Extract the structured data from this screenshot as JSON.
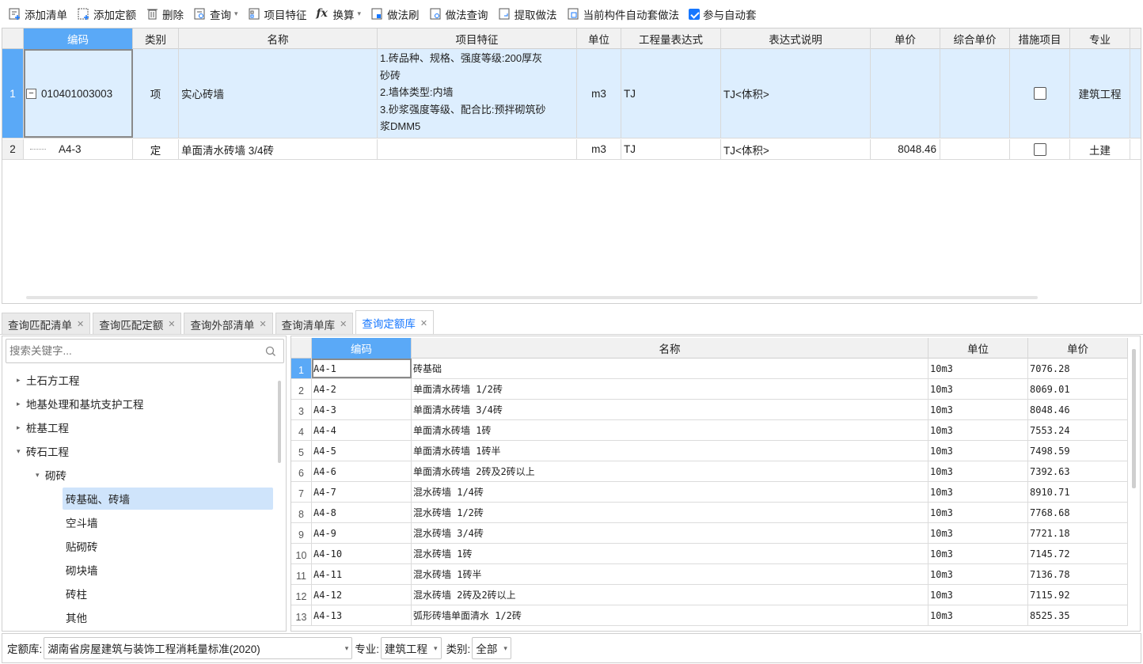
{
  "toolbar": {
    "items": [
      {
        "label": "添加清单",
        "icon": "add-list-icon"
      },
      {
        "label": "添加定额",
        "icon": "add-quota-icon"
      },
      {
        "label": "删除",
        "icon": "trash-icon"
      },
      {
        "label": "查询",
        "icon": "query-icon",
        "dropdown": true
      },
      {
        "label": "项目特征",
        "icon": "feature-icon"
      },
      {
        "label": "换算",
        "icon": "fx-icon",
        "dropdown": true
      },
      {
        "label": "做法刷",
        "icon": "brush-icon"
      },
      {
        "label": "做法查询",
        "icon": "method-query-icon"
      },
      {
        "label": "提取做法",
        "icon": "extract-icon"
      },
      {
        "label": "当前构件自动套做法",
        "icon": "auto-apply-icon"
      }
    ],
    "auto_checkbox_label": "参与自动套",
    "auto_checked": true
  },
  "top_grid": {
    "headers": [
      "编码",
      "类别",
      "名称",
      "项目特征",
      "单位",
      "工程量表达式",
      "表达式说明",
      "单价",
      "综合单价",
      "措施项目",
      "专业"
    ],
    "rows": [
      {
        "num": "1",
        "code": "010401003003",
        "type": "项",
        "name": "实心砖墙",
        "feature": "1.砖品种、规格、强度等级:200厚灰\n砂砖\n2.墙体类型:内墙\n3.砂浆强度等级、配合比:预拌砌筑砂\n浆DMM5",
        "unit": "m3",
        "expr": "TJ",
        "expr_desc": "TJ<体积>",
        "price": "",
        "total_price": "",
        "measure": false,
        "major": "建筑工程"
      },
      {
        "num": "2",
        "code": "A4-3",
        "type": "定",
        "name": "单面清水砖墙 3/4砖",
        "feature": "",
        "unit": "m3",
        "expr": "TJ",
        "expr_desc": "TJ<体积>",
        "price": "8048.46",
        "total_price": "",
        "measure": false,
        "major": "土建"
      }
    ]
  },
  "tabs": [
    {
      "label": "查询匹配清单",
      "active": false
    },
    {
      "label": "查询匹配定额",
      "active": false
    },
    {
      "label": "查询外部清单",
      "active": false
    },
    {
      "label": "查询清单库",
      "active": false
    },
    {
      "label": "查询定额库",
      "active": true
    }
  ],
  "search": {
    "placeholder": "搜索关键字..."
  },
  "tree": [
    {
      "label": "土石方工程",
      "level": 0,
      "arrow": "right"
    },
    {
      "label": "地基处理和基坑支护工程",
      "level": 0,
      "arrow": "right"
    },
    {
      "label": "桩基工程",
      "level": 0,
      "arrow": "right"
    },
    {
      "label": "砖石工程",
      "level": 0,
      "arrow": "down"
    },
    {
      "label": "砌砖",
      "level": 1,
      "arrow": "down"
    },
    {
      "label": "砖基础、砖墙",
      "level": 2,
      "arrow": "",
      "selected": true
    },
    {
      "label": "空斗墙",
      "level": 2,
      "arrow": ""
    },
    {
      "label": "贴砌砖",
      "level": 2,
      "arrow": ""
    },
    {
      "label": "砌块墙",
      "level": 2,
      "arrow": ""
    },
    {
      "label": "砖柱",
      "level": 2,
      "arrow": ""
    },
    {
      "label": "其他",
      "level": 2,
      "arrow": ""
    }
  ],
  "quota_grid": {
    "headers": [
      "编码",
      "名称",
      "单位",
      "单价"
    ],
    "rows": [
      {
        "num": "1",
        "code": "A4-1",
        "name": "砖基础",
        "unit": "10m3",
        "price": "7076.28"
      },
      {
        "num": "2",
        "code": "A4-2",
        "name": "单面清水砖墙 1/2砖",
        "unit": "10m3",
        "price": "8069.01"
      },
      {
        "num": "3",
        "code": "A4-3",
        "name": "单面清水砖墙 3/4砖",
        "unit": "10m3",
        "price": "8048.46"
      },
      {
        "num": "4",
        "code": "A4-4",
        "name": "单面清水砖墙 1砖",
        "unit": "10m3",
        "price": "7553.24"
      },
      {
        "num": "5",
        "code": "A4-5",
        "name": "单面清水砖墙 1砖半",
        "unit": "10m3",
        "price": "7498.59"
      },
      {
        "num": "6",
        "code": "A4-6",
        "name": "单面清水砖墙 2砖及2砖以上",
        "unit": "10m3",
        "price": "7392.63"
      },
      {
        "num": "7",
        "code": "A4-7",
        "name": "混水砖墙 1/4砖",
        "unit": "10m3",
        "price": "8910.71"
      },
      {
        "num": "8",
        "code": "A4-8",
        "name": "混水砖墙 1/2砖",
        "unit": "10m3",
        "price": "7768.68"
      },
      {
        "num": "9",
        "code": "A4-9",
        "name": "混水砖墙 3/4砖",
        "unit": "10m3",
        "price": "7721.18"
      },
      {
        "num": "10",
        "code": "A4-10",
        "name": "混水砖墙 1砖",
        "unit": "10m3",
        "price": "7145.72"
      },
      {
        "num": "11",
        "code": "A4-11",
        "name": "混水砖墙 1砖半",
        "unit": "10m3",
        "price": "7136.78"
      },
      {
        "num": "12",
        "code": "A4-12",
        "name": "混水砖墙 2砖及2砖以上",
        "unit": "10m3",
        "price": "7115.92"
      },
      {
        "num": "13",
        "code": "A4-13",
        "name": "弧形砖墙单面清水 1/2砖",
        "unit": "10m3",
        "price": "8525.35"
      }
    ]
  },
  "bottom": {
    "lib_label": "定额库:",
    "lib_value": "湖南省房屋建筑与装饰工程消耗量标准(2020)",
    "major_label": "专业:",
    "major_value": "建筑工程",
    "cat_label": "类别:",
    "cat_value": "全部"
  },
  "colors": {
    "accent": "#1677ff",
    "header_selected": "#5aa9f7",
    "row_selected": "#ddeefe"
  }
}
